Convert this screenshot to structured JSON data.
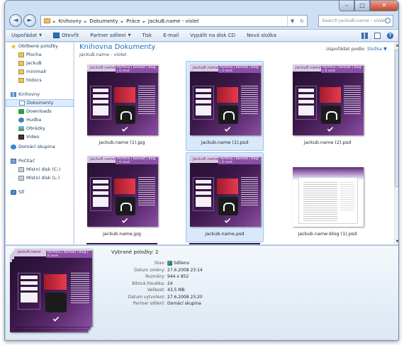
{
  "window": {
    "controls": {
      "min": "–",
      "max": "□",
      "close": "✕"
    }
  },
  "nav": {
    "back_icon": "left-arrow",
    "forward_icon": "right-arrow",
    "breadcrumb": [
      "Knihovny",
      "Dokumenty",
      "Práce",
      "JackuB.name - violet"
    ],
    "separator": "►",
    "search_placeholder": "Search JackuB.name - violet"
  },
  "toolbar": {
    "items": [
      "Uspořádat",
      "Otevřít",
      "Partner sdílení",
      "Tisk",
      "E-mail",
      "Vypálit na disk CD",
      "Nová složka"
    ]
  },
  "sidebar": {
    "items": [
      {
        "label": "Oblíbené položky",
        "icon": "star-icon",
        "level": 0
      },
      {
        "label": "Plocha",
        "icon": "desktop-icon",
        "level": 1
      },
      {
        "label": "JackuB",
        "icon": "folder-icon",
        "level": 1
      },
      {
        "label": "minimalr",
        "icon": "folder-icon",
        "level": 1
      },
      {
        "label": "htdocs",
        "icon": "folder-icon",
        "level": 1
      },
      {
        "label": "Knihovny",
        "icon": "library-icon",
        "level": 0
      },
      {
        "label": "Dokumenty",
        "icon": "documents-icon",
        "level": 1,
        "selected": true
      },
      {
        "label": "Downloads",
        "icon": "downloads-icon",
        "level": 1
      },
      {
        "label": "Hudba",
        "icon": "music-icon",
        "level": 1
      },
      {
        "label": "Obrázky",
        "icon": "pictures-icon",
        "level": 1
      },
      {
        "label": "Video",
        "icon": "video-icon",
        "level": 1
      },
      {
        "label": "Domácí skupina",
        "icon": "homegroup-icon",
        "level": 0
      },
      {
        "label": "Počítač",
        "icon": "computer-icon",
        "level": 0
      },
      {
        "label": "Místní disk (C:)",
        "icon": "drive-icon",
        "level": 1
      },
      {
        "label": "Místní disk (L:)",
        "icon": "drive-icon",
        "level": 1
      },
      {
        "label": "Síť",
        "icon": "network-icon",
        "level": 0
      }
    ]
  },
  "library": {
    "title": "Knihovna Dokumenty",
    "subtitle": "JackuB.name - violet",
    "arrange_label": "Uspořádat podle:",
    "arrange_value": "Složka"
  },
  "files": [
    {
      "name": "jackub.name (1).jpg",
      "selected": false,
      "kind": "site"
    },
    {
      "name": "jackub.name (1).psd",
      "selected": true,
      "kind": "site"
    },
    {
      "name": "jackub.name (2).psd",
      "selected": false,
      "kind": "site"
    },
    {
      "name": "jackub.name.jpg",
      "selected": false,
      "kind": "site"
    },
    {
      "name": "jackub.name.psd",
      "selected": true,
      "kind": "site"
    },
    {
      "name": "jackub.name-blog (1).psd",
      "selected": false,
      "kind": "blog"
    }
  ],
  "thumb_text": {
    "logo": "JackuB.name",
    "nav": "Portfolio | Kontakt | Blog | O mně"
  },
  "details": {
    "selected_count": "Vybrané položky: 2",
    "props": [
      {
        "k": "Stav:",
        "v": "Sdíleno",
        "share": true
      },
      {
        "k": "Datum změny:",
        "v": "27.6.2008 23:14"
      },
      {
        "k": "Rozměry:",
        "v": "944 x 852"
      },
      {
        "k": "Bitová hloubka:",
        "v": "24"
      },
      {
        "k": "Velikost:",
        "v": "43,5 MB"
      },
      {
        "k": "Datum vytvoření:",
        "v": "27.6.2008 23:20"
      },
      {
        "k": "Partner sdílení:",
        "v": "Domácí skupina"
      }
    ]
  }
}
